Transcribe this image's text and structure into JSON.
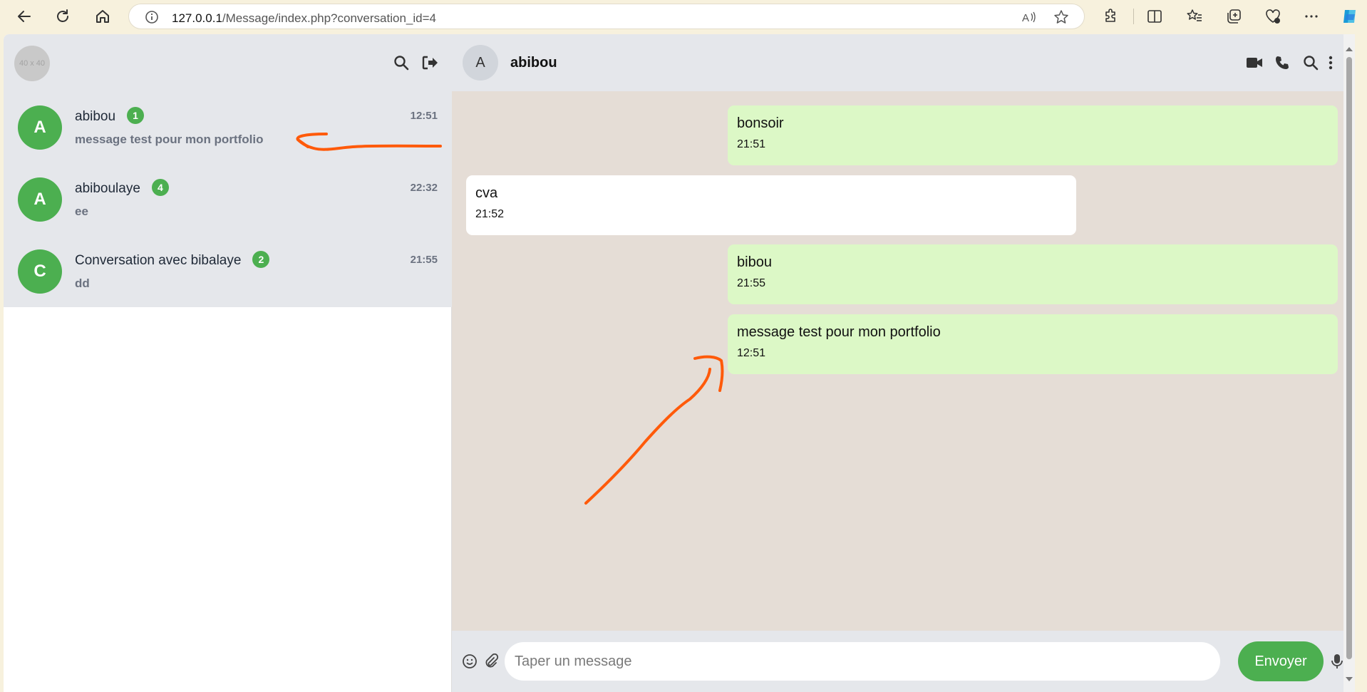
{
  "browser": {
    "url_host": "127.0.0.1",
    "url_path": "/Message/index.php?conversation_id=4",
    "icons": [
      "back-icon",
      "refresh-icon",
      "home-icon",
      "info-icon",
      "read-aloud-icon",
      "favorite-star-icon",
      "extensions-icon",
      "split-screen-icon",
      "favorites-icon",
      "collections-icon",
      "browser-essentials-icon",
      "more-icon",
      "copilot-icon"
    ]
  },
  "sidebar": {
    "my_avatar_placeholder": "40 x 40",
    "icons": [
      "search-icon",
      "logout-icon"
    ],
    "conversations": [
      {
        "initial": "A",
        "name": "abibou",
        "badge": "1",
        "time": "12:51",
        "preview": "message test pour mon portfolio"
      },
      {
        "initial": "A",
        "name": "abiboulaye",
        "badge": "4",
        "time": "22:32",
        "preview": "ee"
      },
      {
        "initial": "C",
        "name": "Conversation avec bibalaye",
        "badge": "2",
        "time": "21:55",
        "preview": "dd"
      }
    ]
  },
  "chat": {
    "contact_initial": "A",
    "contact_name": "abibou",
    "header_icons": [
      "video-call-icon",
      "phone-icon",
      "search-icon",
      "more-vertical-icon"
    ],
    "messages": [
      {
        "direction": "sent",
        "text": "bonsoir",
        "time": "21:51"
      },
      {
        "direction": "received",
        "text": "cva",
        "time": "21:52"
      },
      {
        "direction": "sent",
        "text": "bibou",
        "time": "21:55"
      },
      {
        "direction": "sent",
        "text": "message test pour mon portfolio",
        "time": "12:51"
      }
    ],
    "composer": {
      "placeholder": "Taper un message",
      "value": "",
      "send_label": "Envoyer",
      "icons": [
        "emoji-icon",
        "attach-icon",
        "microphone-icon"
      ]
    }
  },
  "colors": {
    "accent_green": "#4caf50",
    "sent_bubble": "#dcf8c6",
    "chat_background": "#e5ddd6",
    "annotation_stroke": "#ff5a0a"
  }
}
